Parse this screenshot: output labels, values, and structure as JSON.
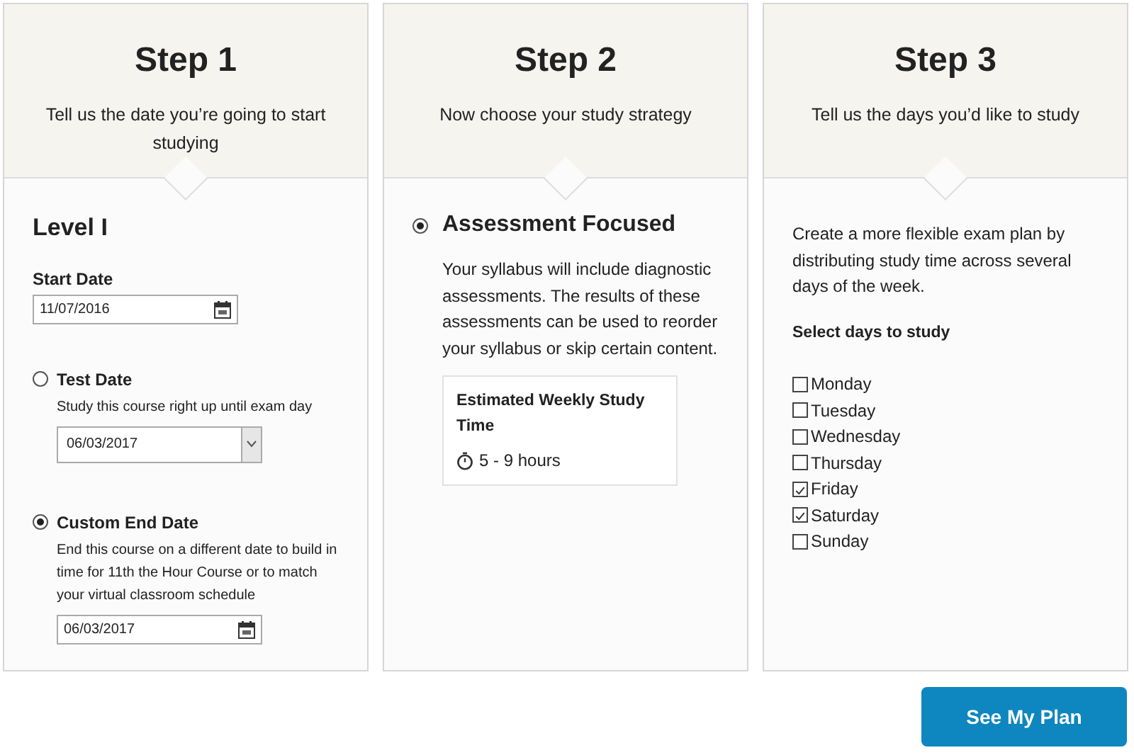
{
  "steps": [
    {
      "title": "Step 1",
      "description": "Tell us the date you’re going to start studying"
    },
    {
      "title": "Step 2",
      "description": "Now choose your study strategy"
    },
    {
      "title": "Step 3",
      "description": "Tell us the days you’d like to study"
    }
  ],
  "step1": {
    "heading": "Level I",
    "start_date": {
      "label": "Start Date",
      "value": "11/07/2016"
    },
    "options": [
      {
        "kind": "dropdown",
        "label": "Test Date",
        "selected": false,
        "hint": "Study this course right up until exam day",
        "value": "06/03/2017"
      },
      {
        "kind": "date",
        "label": "Custom End Date",
        "selected": true,
        "hint": "End this course on a different date to build in time for 11th the Hour Course or to match your virtual classroom schedule",
        "value": "06/03/2017"
      }
    ]
  },
  "step2": {
    "strategies": [
      {
        "label": "Assessment Focused",
        "selected": true,
        "description": "Your syllabus will include diagnostic assessments. The results of these assessments can be used to reorder your syllabus or skip certain content."
      }
    ],
    "estimate": {
      "title": "Estimated Weekly Study Time",
      "value": "5 - 9 hours"
    }
  },
  "step3": {
    "description": "Create a more flexible exam plan by distributing study time across several days of the week.",
    "days_label": "Select days to study",
    "days": [
      {
        "label": "Monday",
        "checked": false
      },
      {
        "label": "Tuesday",
        "checked": false
      },
      {
        "label": "Wednesday",
        "checked": false
      },
      {
        "label": "Thursday",
        "checked": false
      },
      {
        "label": "Friday",
        "checked": true
      },
      {
        "label": "Saturday",
        "checked": true
      },
      {
        "label": "Sunday",
        "checked": false
      }
    ]
  },
  "button": "See My Plan"
}
